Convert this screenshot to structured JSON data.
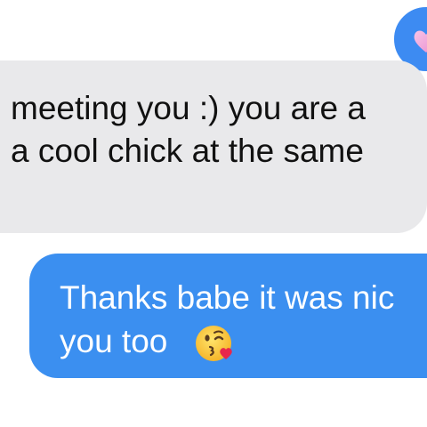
{
  "conversation": {
    "received_message": {
      "line1": "meeting you :) you are a",
      "line2": "a cool chick at the same"
    },
    "sent_message": {
      "line1": "Thanks babe it was nic",
      "line2": "you too",
      "emoji": "face-blowing-a-kiss-icon"
    },
    "reaction": {
      "icon": "heart-icon"
    }
  },
  "colors": {
    "sent_bubble": "#3b8ff0",
    "received_bubble": "#e9e9eb",
    "reaction_circle": "#3d8bf2",
    "heart": "#f4a6d7"
  }
}
